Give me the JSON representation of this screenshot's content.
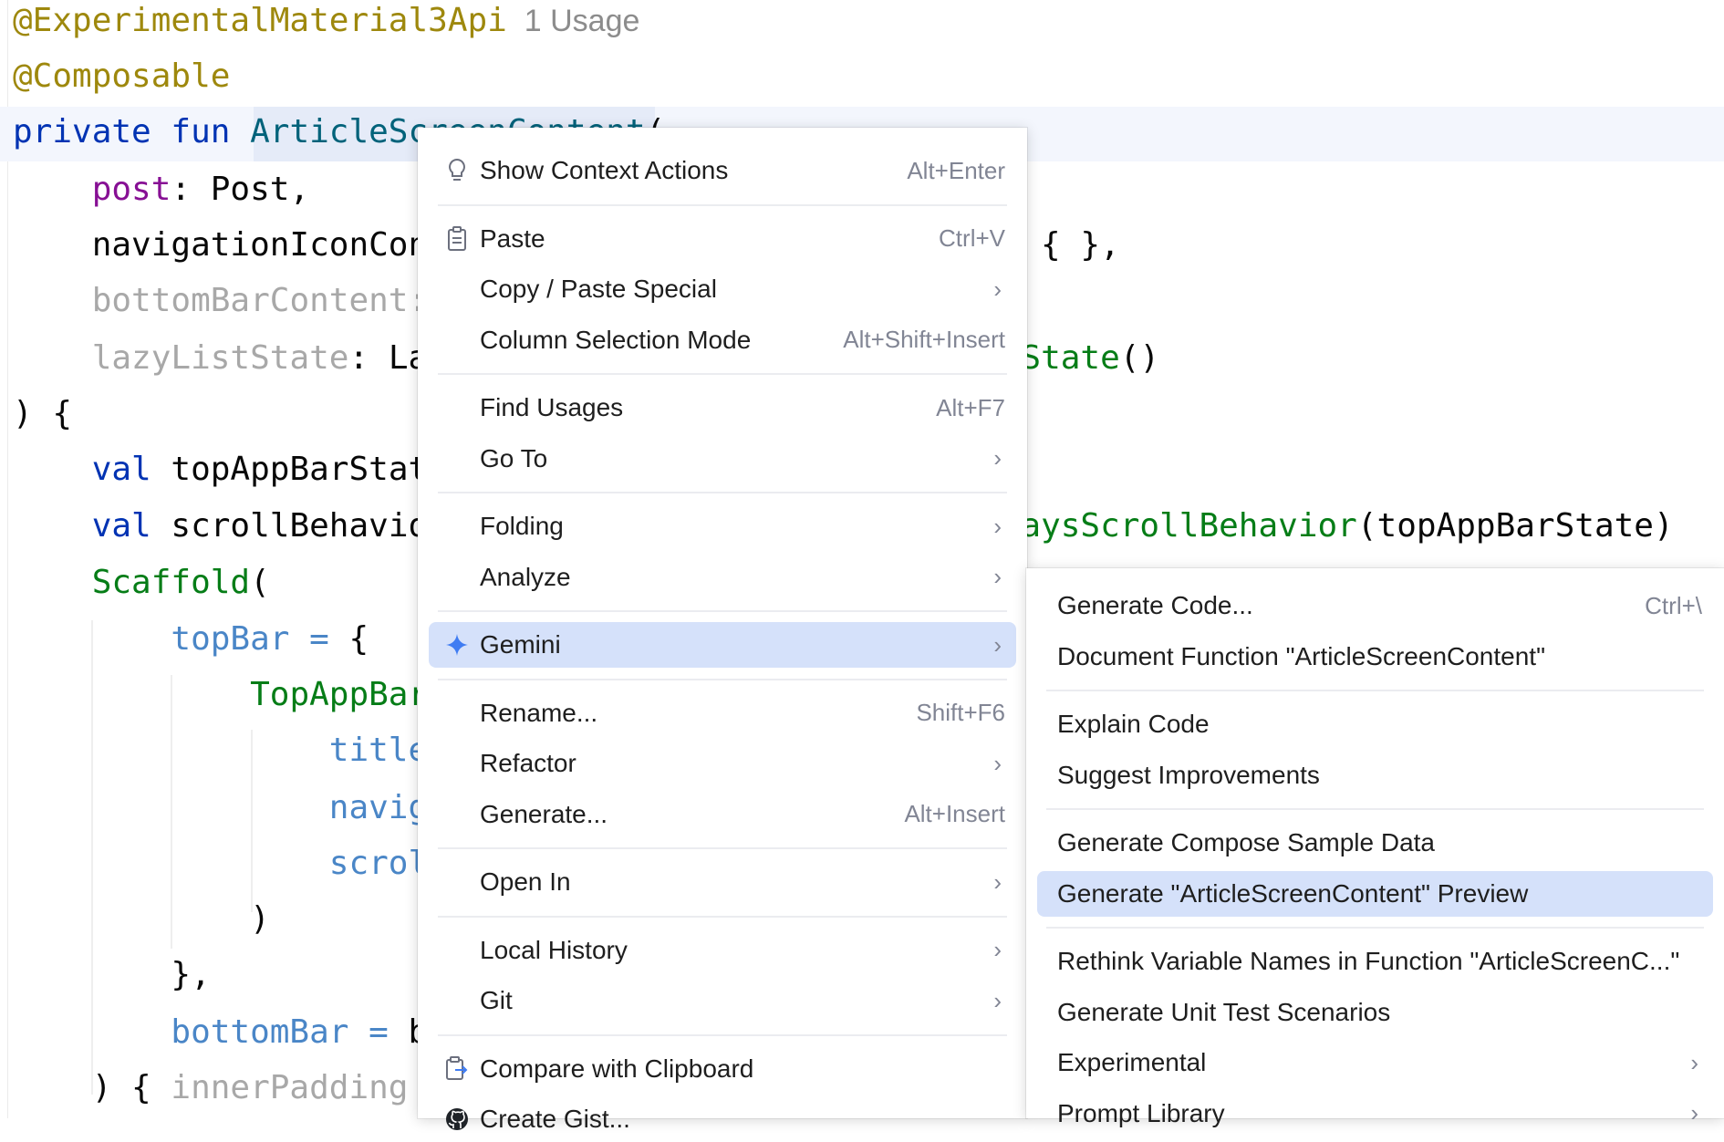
{
  "editor": {
    "lines": [
      {
        "segs": [
          {
            "c": "ann",
            "t": "@ExperimentalMaterial3Api"
          },
          {
            "c": "hint",
            "t": "  1 Usage"
          }
        ]
      },
      {
        "segs": [
          {
            "c": "ann",
            "t": "@Composable"
          }
        ]
      },
      {
        "segs": [
          {
            "c": "k",
            "t": "private fun "
          },
          {
            "c": "fn",
            "t": "ArticleScreenContent"
          },
          {
            "c": "",
            "t": "("
          }
        ]
      },
      {
        "segs": [
          {
            "c": "",
            "t": "    "
          },
          {
            "c": "prm",
            "t": "post"
          },
          {
            "c": "",
            "t": ": Post,"
          }
        ]
      },
      {
        "segs": [
          {
            "c": "",
            "t": "    navigationIconContent: @Composable () -> Unit = { },"
          }
        ]
      },
      {
        "segs": [
          {
            "c": "",
            "t": "    "
          },
          {
            "c": "dim",
            "t": "bottomBarContent: @Composable () -> Unit = { },"
          }
        ]
      },
      {
        "segs": [
          {
            "c": "",
            "t": "    "
          },
          {
            "c": "dim",
            "t": "lazyListState"
          },
          {
            "c": "",
            "t": ": LazyListState = "
          },
          {
            "c": "comp",
            "t": "rememberLazyListState"
          },
          {
            "c": "",
            "t": "()"
          }
        ]
      },
      {
        "segs": [
          {
            "c": "",
            "t": ") {"
          }
        ]
      },
      {
        "segs": [
          {
            "c": "",
            "t": "    "
          },
          {
            "c": "k",
            "t": "val "
          },
          {
            "c": "",
            "t": "topAppBarState = rememberTopAppBarState()"
          }
        ]
      },
      {
        "segs": [
          {
            "c": "",
            "t": "    "
          },
          {
            "c": "k",
            "t": "val "
          },
          {
            "c": "",
            "t": "scrollBehavior = TopAppBarDefaults."
          },
          {
            "c": "comp",
            "t": "enterAlwaysScrollBehavior"
          },
          {
            "c": "",
            "t": "(topAppBarState)"
          }
        ]
      },
      {
        "segs": [
          {
            "c": "",
            "t": "    "
          },
          {
            "c": "comp",
            "t": "Scaffold"
          },
          {
            "c": "",
            "t": "("
          }
        ]
      },
      {
        "segs": [
          {
            "c": "",
            "t": "        "
          },
          {
            "c": "named",
            "t": "topBar = "
          },
          {
            "c": "",
            "t": "{"
          }
        ]
      },
      {
        "segs": [
          {
            "c": "",
            "t": "            "
          },
          {
            "c": "comp",
            "t": "TopAppBar"
          },
          {
            "c": "",
            "t": "("
          }
        ]
      },
      {
        "segs": [
          {
            "c": "",
            "t": "                "
          },
          {
            "c": "named",
            "t": "title"
          }
        ]
      },
      {
        "segs": [
          {
            "c": "",
            "t": "                "
          },
          {
            "c": "named",
            "t": "navigationIcon"
          }
        ]
      },
      {
        "segs": [
          {
            "c": "",
            "t": "                "
          },
          {
            "c": "named",
            "t": "scrollBehavior"
          }
        ]
      },
      {
        "segs": [
          {
            "c": "",
            "t": "            )"
          }
        ]
      },
      {
        "segs": [
          {
            "c": "",
            "t": "        },"
          }
        ]
      },
      {
        "segs": [
          {
            "c": "",
            "t": "        "
          },
          {
            "c": "named",
            "t": "bottomBar = "
          },
          {
            "c": "",
            "t": "bottomBarContent"
          }
        ]
      },
      {
        "segs": [
          {
            "c": "",
            "t": "    ) { "
          },
          {
            "c": "dim",
            "t": "innerPadding"
          },
          {
            "c": "",
            "t": " ->"
          }
        ]
      }
    ]
  },
  "context_menu": {
    "items": [
      {
        "name": "show-context-actions",
        "label": "Show Context Actions",
        "shortcut": "Alt+Enter",
        "icon": "lightbulb-icon"
      },
      {
        "sep": true
      },
      {
        "name": "paste",
        "label": "Paste",
        "shortcut": "Ctrl+V",
        "icon": "clipboard-icon"
      },
      {
        "name": "copy-paste-special",
        "label": "Copy / Paste Special",
        "submenu": true
      },
      {
        "name": "column-selection-mode",
        "label": "Column Selection Mode",
        "shortcut": "Alt+Shift+Insert"
      },
      {
        "sep": true
      },
      {
        "name": "find-usages",
        "label": "Find Usages",
        "shortcut": "Alt+F7"
      },
      {
        "name": "go-to",
        "label": "Go To",
        "submenu": true
      },
      {
        "sep": true
      },
      {
        "name": "folding",
        "label": "Folding",
        "submenu": true
      },
      {
        "name": "analyze",
        "label": "Analyze",
        "submenu": true
      },
      {
        "sep": true
      },
      {
        "name": "gemini",
        "label": "Gemini",
        "submenu": true,
        "selected": true,
        "icon": "gemini-sparkle-icon"
      },
      {
        "sep": true
      },
      {
        "name": "rename",
        "label": "Rename...",
        "shortcut": "Shift+F6"
      },
      {
        "name": "refactor",
        "label": "Refactor",
        "submenu": true
      },
      {
        "name": "generate",
        "label": "Generate...",
        "shortcut": "Alt+Insert"
      },
      {
        "sep": true
      },
      {
        "name": "open-in",
        "label": "Open In",
        "submenu": true
      },
      {
        "sep": true
      },
      {
        "name": "local-history",
        "label": "Local History",
        "submenu": true
      },
      {
        "name": "git",
        "label": "Git",
        "submenu": true
      },
      {
        "sep": true
      },
      {
        "name": "compare-with-clipboard",
        "label": "Compare with Clipboard",
        "icon": "compare-clipboard-icon"
      },
      {
        "name": "create-gist",
        "label": "Create Gist...",
        "icon": "github-icon"
      }
    ]
  },
  "gemini_submenu": {
    "items": [
      {
        "name": "generate-code",
        "label": "Generate Code...",
        "shortcut": "Ctrl+\\"
      },
      {
        "name": "document-function",
        "label": "Document Function \"ArticleScreenContent\""
      },
      {
        "sep": true
      },
      {
        "name": "explain-code",
        "label": "Explain Code"
      },
      {
        "name": "suggest-improvements",
        "label": "Suggest Improvements"
      },
      {
        "sep": true
      },
      {
        "name": "generate-compose-sample-data",
        "label": "Generate Compose Sample Data"
      },
      {
        "name": "generate-preview",
        "label": "Generate \"ArticleScreenContent\" Preview",
        "selected": true
      },
      {
        "sep": true
      },
      {
        "name": "rethink-variable-names",
        "label": "Rethink Variable Names in Function \"ArticleScreenC...\""
      },
      {
        "name": "generate-unit-test-scenarios",
        "label": "Generate Unit Test Scenarios"
      },
      {
        "name": "experimental",
        "label": "Experimental",
        "submenu": true
      },
      {
        "name": "prompt-library",
        "label": "Prompt Library",
        "submenu": true
      }
    ]
  },
  "colors": {
    "menu_selected": "#d5e1fa",
    "gemini_accent": "#3f7cf2",
    "annotation": "#9e880d",
    "keyword": "#0033b3",
    "function_name": "#00627a",
    "composable_call": "#067d17"
  }
}
